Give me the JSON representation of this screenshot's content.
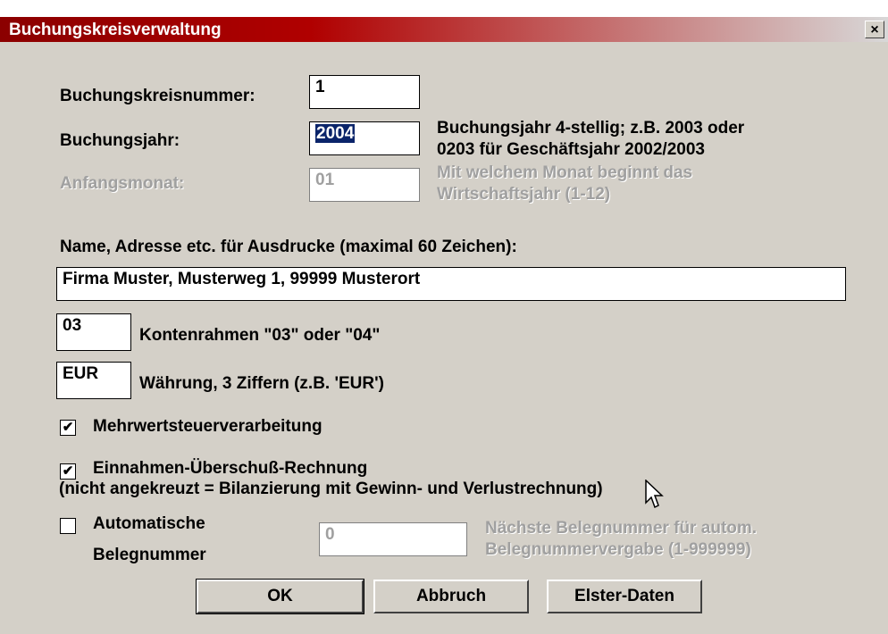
{
  "window": {
    "title": "Buchungskreisverwaltung",
    "close_glyph": "×"
  },
  "form": {
    "buchungskreisnummer_label": "Buchungskreisnummer:",
    "buchungskreisnummer_value": "1",
    "buchungsjahr_label": "Buchungsjahr:",
    "buchungsjahr_value": "2004",
    "buchungsjahr_hint_line1": "Buchungsjahr 4-stellig; z.B. 2003 oder",
    "buchungsjahr_hint_line2": "0203 für Geschäftsjahr 2002/2003",
    "anfangsmonat_label": "Anfangsmonat:",
    "anfangsmonat_value": "01",
    "anfangsmonat_hint_line1": "Mit welchem Monat beginnt das",
    "anfangsmonat_hint_line2": "Wirtschaftsjahr (1-12)",
    "name_label": "Name, Adresse etc. für Ausdrucke (maximal 60 Zeichen):",
    "name_value": "Firma Muster, Musterweg 1, 99999 Musterort",
    "kontenrahmen_value": "03",
    "kontenrahmen_label": "Kontenrahmen \"03\" oder \"04\"",
    "waehrung_value": "EUR",
    "waehrung_label": "Währung,  3 Ziffern (z.B. 'EUR')",
    "mwst_label": "Mehrwertsteuerverarbeitung",
    "mwst_checked": "✔",
    "eur_label_line1": "Einnahmen-Überschuß-Rechnung",
    "eur_label_line2": "(nicht angekreuzt = Bilanzierung mit Gewinn- und Verlustrechnung)",
    "eur_checked": "✔",
    "autobeleg_label_line1": "Automatische",
    "autobeleg_label_line2": "Belegnummer",
    "autobeleg_checked": "",
    "belegnummer_value": "0",
    "belegnummer_hint_line1": "Nächste Belegnummer für autom.",
    "belegnummer_hint_line2": "Belegnummervergabe (1-999999)"
  },
  "buttons": {
    "ok": "OK",
    "abbruch": "Abbruch",
    "elster": "Elster-Daten"
  },
  "icons": {
    "close": "close-icon",
    "checkmark": "checkmark-icon",
    "cursor": "mouse-pointer-icon"
  }
}
